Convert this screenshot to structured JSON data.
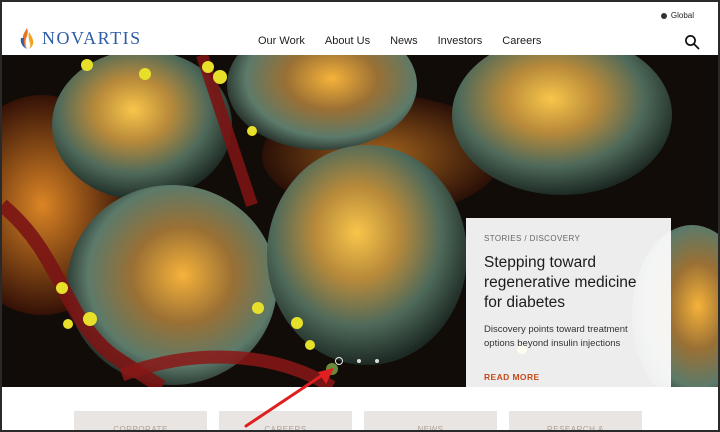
{
  "header": {
    "global_label": "Global",
    "logo_text": "NOVARTIS",
    "nav": [
      "Our Work",
      "About Us",
      "News",
      "Investors",
      "Careers"
    ]
  },
  "hero": {
    "breadcrumb": "STORIES / DISCOVERY",
    "title": "Stepping toward regenerative medicine for diabetes",
    "summary": "Discovery points toward treatment options beyond insulin injections",
    "read_more": "READ MORE",
    "carousel_dots": 3,
    "active_dot": 0
  },
  "tiles": [
    "CORPORATE",
    "CAREERS",
    "NEWS",
    "RESEARCH &"
  ],
  "colors": {
    "brand_blue": "#2d5ca6",
    "accent_orange": "#c84a1c",
    "annotation_arrow": "#e02020"
  }
}
